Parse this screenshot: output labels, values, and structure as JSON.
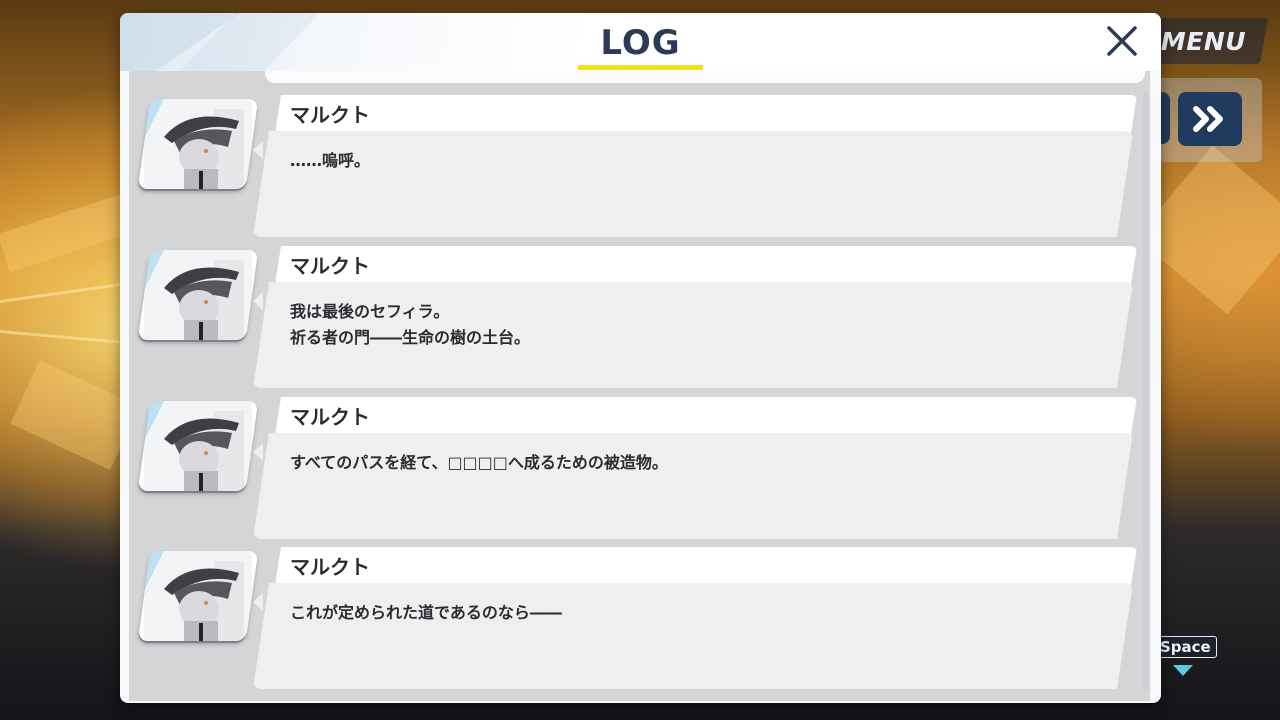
{
  "hud": {
    "menu_label": "MENU",
    "skip_icon": "double-chevron-right-icon",
    "space_label": "Space"
  },
  "log": {
    "title": "LOG",
    "close_icon": "close-icon",
    "accent_color": "#f2e018",
    "entries": [
      {
        "speaker": "マルクト",
        "lines": [
          "……嗚呼。",
          ""
        ]
      },
      {
        "speaker": "マルクト",
        "lines": [
          "我は最後のセフィラ。",
          "祈る者の門――生命の樹の土台。"
        ]
      },
      {
        "speaker": "マルクト",
        "lines": [
          "すべてのパスを経て、□□□□へ成るための被造物。",
          ""
        ]
      },
      {
        "speaker": "マルクト",
        "lines": [
          "これが定められた道であるのなら――",
          ""
        ]
      }
    ]
  }
}
